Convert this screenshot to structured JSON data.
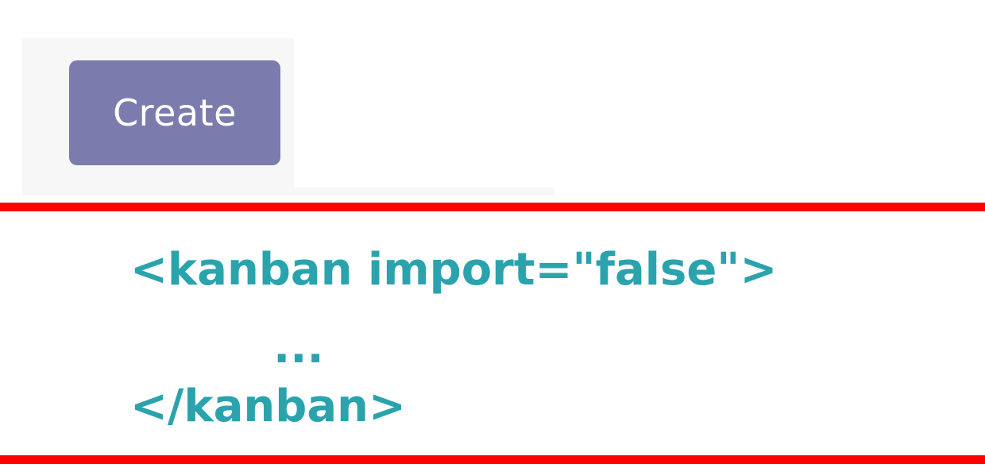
{
  "toolbar": {
    "create_label": "Create",
    "create_color": "#7c7bad"
  },
  "dividers": {
    "color": "#ff0000"
  },
  "code": {
    "color": "#2aa3ad",
    "open_tag": "<kanban import=\"false\">",
    "ellipsis": "...",
    "close_tag": "</kanban>"
  }
}
